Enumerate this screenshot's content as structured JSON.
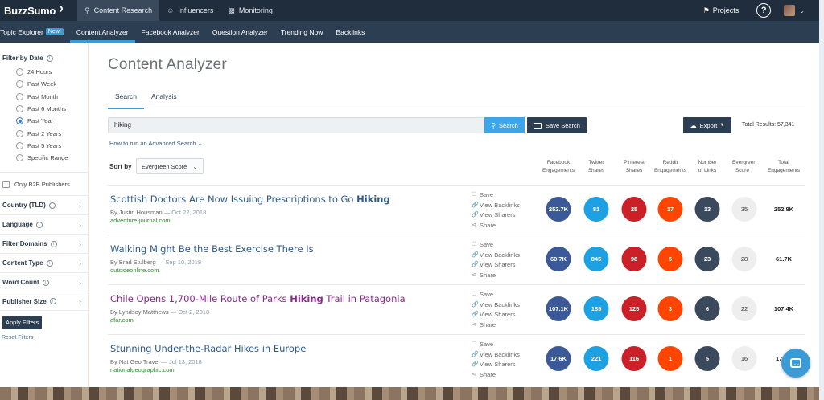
{
  "app": {
    "logo": "BuzzSumo",
    "nav_tabs": [
      {
        "label": "Content Research",
        "icon": "search-icon"
      },
      {
        "label": "Influencers",
        "icon": "person-icon"
      },
      {
        "label": "Monitoring",
        "icon": "bar-chart-icon"
      }
    ],
    "projects_label": "Projects",
    "help_label": "?"
  },
  "subnav": {
    "items": [
      "Topic Explorer",
      "Content Analyzer",
      "Facebook Analyzer",
      "Question Analyzer",
      "Trending Now",
      "Backlinks"
    ],
    "new_badge": "New!",
    "active": "Content Analyzer"
  },
  "sidebar": {
    "filter_by_date": "Filter by Date",
    "date_options": [
      "24 Hours",
      "Past Week",
      "Past Month",
      "Past 6 Months",
      "Past Year",
      "Past 2 Years",
      "Past 5 Years",
      "Specific Range"
    ],
    "selected_date": "Past Year",
    "b2b_label": "Only B2B Publishers",
    "sections": [
      "Country (TLD)",
      "Language",
      "Filter Domains",
      "Content Type",
      "Word Count",
      "Publisher Size"
    ],
    "apply_label": "Apply Filters",
    "reset_label": "Reset Filters"
  },
  "main": {
    "title": "Content Analyzer",
    "tabs": [
      "Search",
      "Analysis"
    ],
    "search_value": "hiking",
    "search_button": "Search",
    "save_search": "Save Search",
    "export": "Export",
    "total_results": "Total Results: 57,341",
    "advanced_search": "How to run an Advanced Search",
    "sort_by_label": "Sort by",
    "sort_value": "Evergreen Score",
    "columns": [
      [
        "Facebook",
        "Engagements"
      ],
      [
        "Twitter",
        "Shares"
      ],
      [
        "Pinterest",
        "Shares"
      ],
      [
        "Reddit",
        "Engagements"
      ],
      [
        "Number",
        "of Links"
      ],
      [
        "Evergreen",
        "Score ↓"
      ],
      [
        "Total",
        "Engagements"
      ]
    ],
    "action_labels": [
      "Save",
      "View Backlinks",
      "View Sharers",
      "Share"
    ]
  },
  "colors": {
    "facebook": "#3b5998",
    "twitter": "#1da1e2",
    "pinterest": "#cb2027",
    "reddit": "#ff4500",
    "links": "#3a4a5c",
    "evergreen": "#eeeeee"
  },
  "results": [
    {
      "title_pre": "Scottish Doctors Are Now Issuing Prescriptions to Go ",
      "title_hl": "Hiking",
      "title_post": "",
      "visited": false,
      "author": "By Justin Housman",
      "date": "Oct 22, 2018",
      "domain": "adventure-journal.com",
      "facebook": "252.7K",
      "twitter": "81",
      "pinterest": "25",
      "reddit": "17",
      "links": "13",
      "evergreen": "35",
      "total": "252.8K"
    },
    {
      "title_pre": "Walking Might Be the Best Exercise There Is",
      "title_hl": "",
      "title_post": "",
      "visited": false,
      "author": "By Brad Stulberg",
      "date": "Sep 10, 2018",
      "domain": "outsideonline.com",
      "facebook": "60.7K",
      "twitter": "845",
      "pinterest": "98",
      "reddit": "5",
      "links": "23",
      "evergreen": "28",
      "total": "61.7K"
    },
    {
      "title_pre": "Chile Opens 1,700-Mile Route of Parks ",
      "title_hl": "Hiking",
      "title_post": " Trail in Patagonia",
      "visited": true,
      "author": "By Lyndsey Matthews",
      "date": "Oct 2, 2018",
      "domain": "afar.com",
      "facebook": "107.1K",
      "twitter": "185",
      "pinterest": "125",
      "reddit": "3",
      "links": "6",
      "evergreen": "22",
      "total": "107.4K"
    },
    {
      "title_pre": "Stunning Under-the-Radar Hikes in Europe",
      "title_hl": "",
      "title_post": "",
      "visited": false,
      "author": "By Nat Geo Travel",
      "date": "Jul 13, 2018",
      "domain": "nationalgeographic.com",
      "facebook": "17.6K",
      "twitter": "221",
      "pinterest": "116",
      "reddit": "1",
      "links": "5",
      "evergreen": "16",
      "total": "17.7K"
    }
  ]
}
